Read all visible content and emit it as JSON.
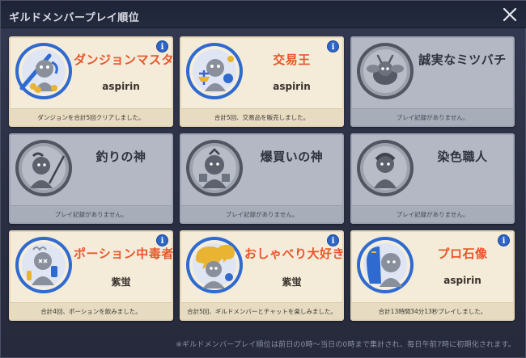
{
  "header": {
    "title": "ギルドメンバープレイ順位"
  },
  "cards": [
    {
      "title": "ダンジョンマスタ",
      "name": "aspirin",
      "footer": "ダンジョンを合計5回クリアしました。",
      "locked": false,
      "icon": "dungeon-knight-icon"
    },
    {
      "title": "交易王",
      "name": "aspirin",
      "footer": "合計5回、交易品を販売しました。",
      "locked": false,
      "icon": "trade-scales-icon"
    },
    {
      "title": "誠実なミツバチ",
      "name": "",
      "footer": "プレイ記録がありません。",
      "locked": true,
      "icon": "bee-icon"
    },
    {
      "title": "釣りの神",
      "name": "",
      "footer": "プレイ記録がありません。",
      "locked": true,
      "icon": "fishing-icon"
    },
    {
      "title": "爆買いの神",
      "name": "",
      "footer": "プレイ記録がありません。",
      "locked": true,
      "icon": "shopping-icon"
    },
    {
      "title": "染色職人",
      "name": "",
      "footer": "プレイ記録がありません。",
      "locked": true,
      "icon": "dye-icon"
    },
    {
      "title": "ポーション中毒者",
      "name": "紫蛍",
      "footer": "合計4回、ポーションを飲みました。",
      "locked": false,
      "icon": "potion-icon"
    },
    {
      "title": "おしゃべり大好き",
      "name": "紫蛍",
      "footer": "合計5回、ギルドメンバーとチャットを楽しみました。",
      "locked": false,
      "icon": "chat-bubble-icon"
    },
    {
      "title": "プロ石像",
      "name": "aspirin",
      "footer": "合計13時間34分13秒プレイしました。",
      "locked": false,
      "icon": "statue-icon"
    }
  ],
  "note": "※ギルドメンバープレイ順位は前日の0時～当日の0時まで集計され、毎日午前7時に初期化されます。",
  "colors": {
    "accent_title": "#e8562a",
    "badge_ring": "#2f6ad0",
    "info": "#2d66c8",
    "locked_card": "#b4b8c4"
  }
}
